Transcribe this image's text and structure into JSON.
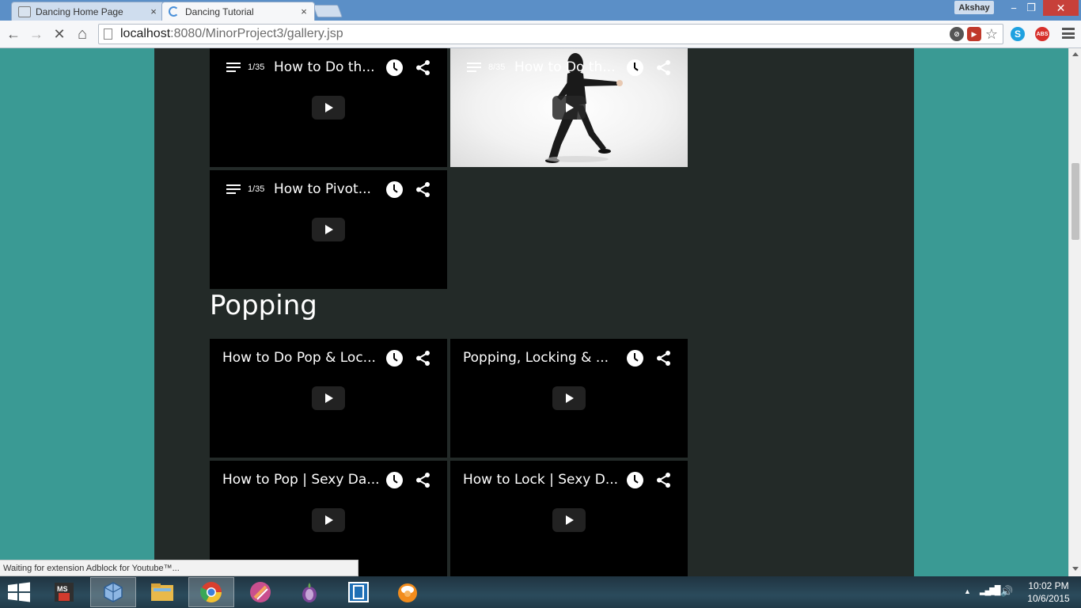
{
  "browser": {
    "tabs": [
      {
        "label": "Dancing Home Page",
        "close": "×"
      },
      {
        "label": "Dancing Tutorial",
        "close": "×"
      }
    ],
    "profile_name": "Akshay",
    "window_controls": {
      "minimize": "−",
      "restore": "❐",
      "close": "✕"
    },
    "nav": {
      "back": "←",
      "forward": "→",
      "stop": "✕",
      "home": "⌂"
    },
    "url_host": "localhost",
    "url_rest": ":8080/MinorProject3/gallery.jsp",
    "extensions": [
      "cancel-extension-icon",
      "video-extension-icon",
      "star-icon",
      "skype-icon",
      "adblock-icon"
    ],
    "status_text": "Waiting for extension Adblock for Youtube™..."
  },
  "gallery": {
    "top_videos": [
      {
        "count": "1/35",
        "title": "How to Do th...",
        "thumbnail": "black"
      },
      {
        "count": "8/35",
        "title": "How to Do th...",
        "thumbnail": "dancer"
      },
      {
        "count": "1/35",
        "title": "How to Pivot...",
        "thumbnail": "black"
      }
    ],
    "section_heading": "Popping",
    "popping_videos": [
      {
        "title": "How to Do Pop & Loc..."
      },
      {
        "title": "Popping, Locking & ..."
      },
      {
        "title": "How to Pop | Sexy Da..."
      },
      {
        "title": "How to Lock | Sexy D..."
      }
    ]
  },
  "taskbar": {
    "apps": [
      "ms-office-icon",
      "virtualbox-icon",
      "file-explorer-icon",
      "chrome-icon",
      "app-icon",
      "tor-icon",
      "window-app-icon",
      "media-player-icon"
    ],
    "tray": {
      "arrow": "▲",
      "signal": "▂▄▆█",
      "volume": "🔊"
    },
    "time": "10:02 PM",
    "date": "10/6/2015"
  },
  "colors": {
    "page_bg": "#3a9a94",
    "content_bg": "#232a28",
    "titlebar": "#5b8fc7",
    "taskbar": "#2b4b5c"
  }
}
